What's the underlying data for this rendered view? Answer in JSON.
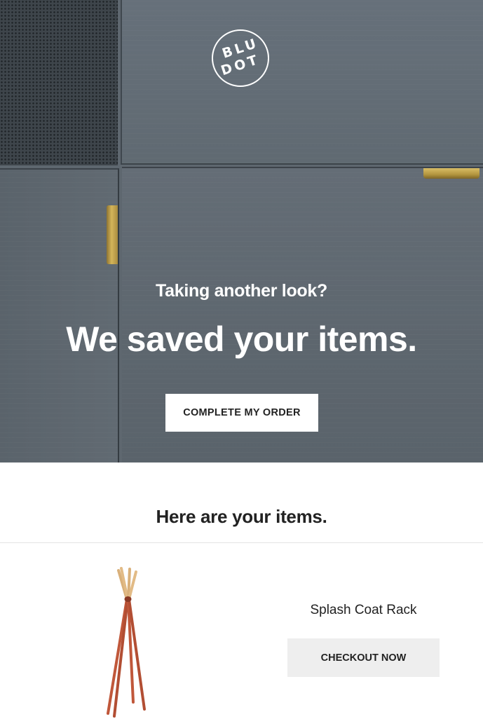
{
  "brand": {
    "logo_line1": "BLU",
    "logo_line2": "DOT"
  },
  "hero": {
    "subhead": "Taking another look?",
    "headline": "We saved your items.",
    "cta_label": "COMPLETE MY ORDER"
  },
  "items_section": {
    "heading": "Here are your items.",
    "items": [
      {
        "name": "Splash Coat Rack",
        "button_label": "CHECKOUT NOW",
        "image_icon": "coat-rack-icon"
      }
    ]
  },
  "colors": {
    "hero_background": "#5e676f",
    "brass_handle": "#c9a94e",
    "text_dark": "#222222",
    "checkout_button_bg": "#eeeeee",
    "coat_rack_red": "#c0573a",
    "coat_rack_wood": "#d9b07a"
  }
}
